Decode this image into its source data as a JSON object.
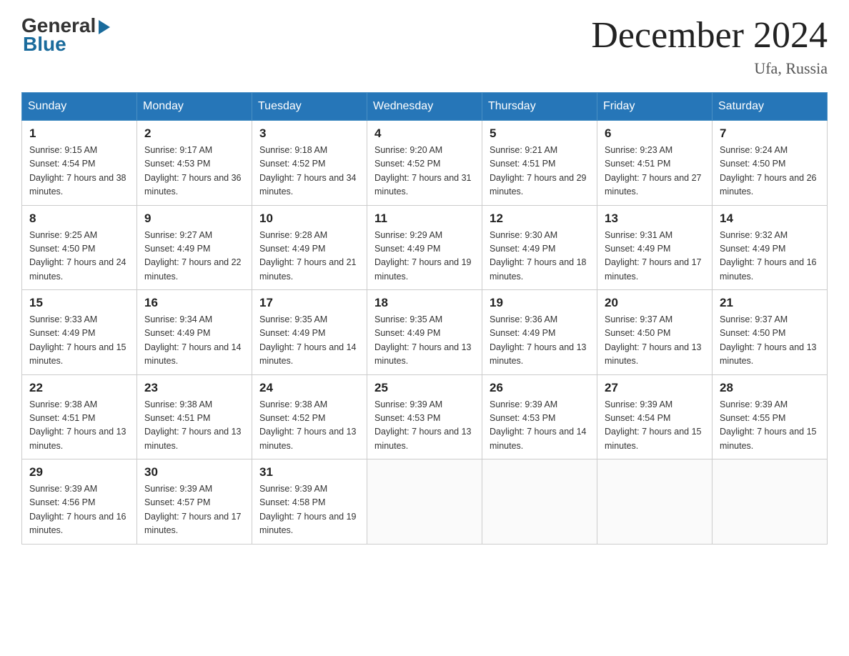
{
  "header": {
    "logo_general": "General",
    "logo_blue": "Blue",
    "month_title": "December 2024",
    "location": "Ufa, Russia"
  },
  "weekdays": [
    "Sunday",
    "Monday",
    "Tuesday",
    "Wednesday",
    "Thursday",
    "Friday",
    "Saturday"
  ],
  "weeks": [
    [
      {
        "day": "1",
        "sunrise": "9:15 AM",
        "sunset": "4:54 PM",
        "daylight": "7 hours and 38 minutes."
      },
      {
        "day": "2",
        "sunrise": "9:17 AM",
        "sunset": "4:53 PM",
        "daylight": "7 hours and 36 minutes."
      },
      {
        "day": "3",
        "sunrise": "9:18 AM",
        "sunset": "4:52 PM",
        "daylight": "7 hours and 34 minutes."
      },
      {
        "day": "4",
        "sunrise": "9:20 AM",
        "sunset": "4:52 PM",
        "daylight": "7 hours and 31 minutes."
      },
      {
        "day": "5",
        "sunrise": "9:21 AM",
        "sunset": "4:51 PM",
        "daylight": "7 hours and 29 minutes."
      },
      {
        "day": "6",
        "sunrise": "9:23 AM",
        "sunset": "4:51 PM",
        "daylight": "7 hours and 27 minutes."
      },
      {
        "day": "7",
        "sunrise": "9:24 AM",
        "sunset": "4:50 PM",
        "daylight": "7 hours and 26 minutes."
      }
    ],
    [
      {
        "day": "8",
        "sunrise": "9:25 AM",
        "sunset": "4:50 PM",
        "daylight": "7 hours and 24 minutes."
      },
      {
        "day": "9",
        "sunrise": "9:27 AM",
        "sunset": "4:49 PM",
        "daylight": "7 hours and 22 minutes."
      },
      {
        "day": "10",
        "sunrise": "9:28 AM",
        "sunset": "4:49 PM",
        "daylight": "7 hours and 21 minutes."
      },
      {
        "day": "11",
        "sunrise": "9:29 AM",
        "sunset": "4:49 PM",
        "daylight": "7 hours and 19 minutes."
      },
      {
        "day": "12",
        "sunrise": "9:30 AM",
        "sunset": "4:49 PM",
        "daylight": "7 hours and 18 minutes."
      },
      {
        "day": "13",
        "sunrise": "9:31 AM",
        "sunset": "4:49 PM",
        "daylight": "7 hours and 17 minutes."
      },
      {
        "day": "14",
        "sunrise": "9:32 AM",
        "sunset": "4:49 PM",
        "daylight": "7 hours and 16 minutes."
      }
    ],
    [
      {
        "day": "15",
        "sunrise": "9:33 AM",
        "sunset": "4:49 PM",
        "daylight": "7 hours and 15 minutes."
      },
      {
        "day": "16",
        "sunrise": "9:34 AM",
        "sunset": "4:49 PM",
        "daylight": "7 hours and 14 minutes."
      },
      {
        "day": "17",
        "sunrise": "9:35 AM",
        "sunset": "4:49 PM",
        "daylight": "7 hours and 14 minutes."
      },
      {
        "day": "18",
        "sunrise": "9:35 AM",
        "sunset": "4:49 PM",
        "daylight": "7 hours and 13 minutes."
      },
      {
        "day": "19",
        "sunrise": "9:36 AM",
        "sunset": "4:49 PM",
        "daylight": "7 hours and 13 minutes."
      },
      {
        "day": "20",
        "sunrise": "9:37 AM",
        "sunset": "4:50 PM",
        "daylight": "7 hours and 13 minutes."
      },
      {
        "day": "21",
        "sunrise": "9:37 AM",
        "sunset": "4:50 PM",
        "daylight": "7 hours and 13 minutes."
      }
    ],
    [
      {
        "day": "22",
        "sunrise": "9:38 AM",
        "sunset": "4:51 PM",
        "daylight": "7 hours and 13 minutes."
      },
      {
        "day": "23",
        "sunrise": "9:38 AM",
        "sunset": "4:51 PM",
        "daylight": "7 hours and 13 minutes."
      },
      {
        "day": "24",
        "sunrise": "9:38 AM",
        "sunset": "4:52 PM",
        "daylight": "7 hours and 13 minutes."
      },
      {
        "day": "25",
        "sunrise": "9:39 AM",
        "sunset": "4:53 PM",
        "daylight": "7 hours and 13 minutes."
      },
      {
        "day": "26",
        "sunrise": "9:39 AM",
        "sunset": "4:53 PM",
        "daylight": "7 hours and 14 minutes."
      },
      {
        "day": "27",
        "sunrise": "9:39 AM",
        "sunset": "4:54 PM",
        "daylight": "7 hours and 15 minutes."
      },
      {
        "day": "28",
        "sunrise": "9:39 AM",
        "sunset": "4:55 PM",
        "daylight": "7 hours and 15 minutes."
      }
    ],
    [
      {
        "day": "29",
        "sunrise": "9:39 AM",
        "sunset": "4:56 PM",
        "daylight": "7 hours and 16 minutes."
      },
      {
        "day": "30",
        "sunrise": "9:39 AM",
        "sunset": "4:57 PM",
        "daylight": "7 hours and 17 minutes."
      },
      {
        "day": "31",
        "sunrise": "9:39 AM",
        "sunset": "4:58 PM",
        "daylight": "7 hours and 19 minutes."
      },
      null,
      null,
      null,
      null
    ]
  ]
}
